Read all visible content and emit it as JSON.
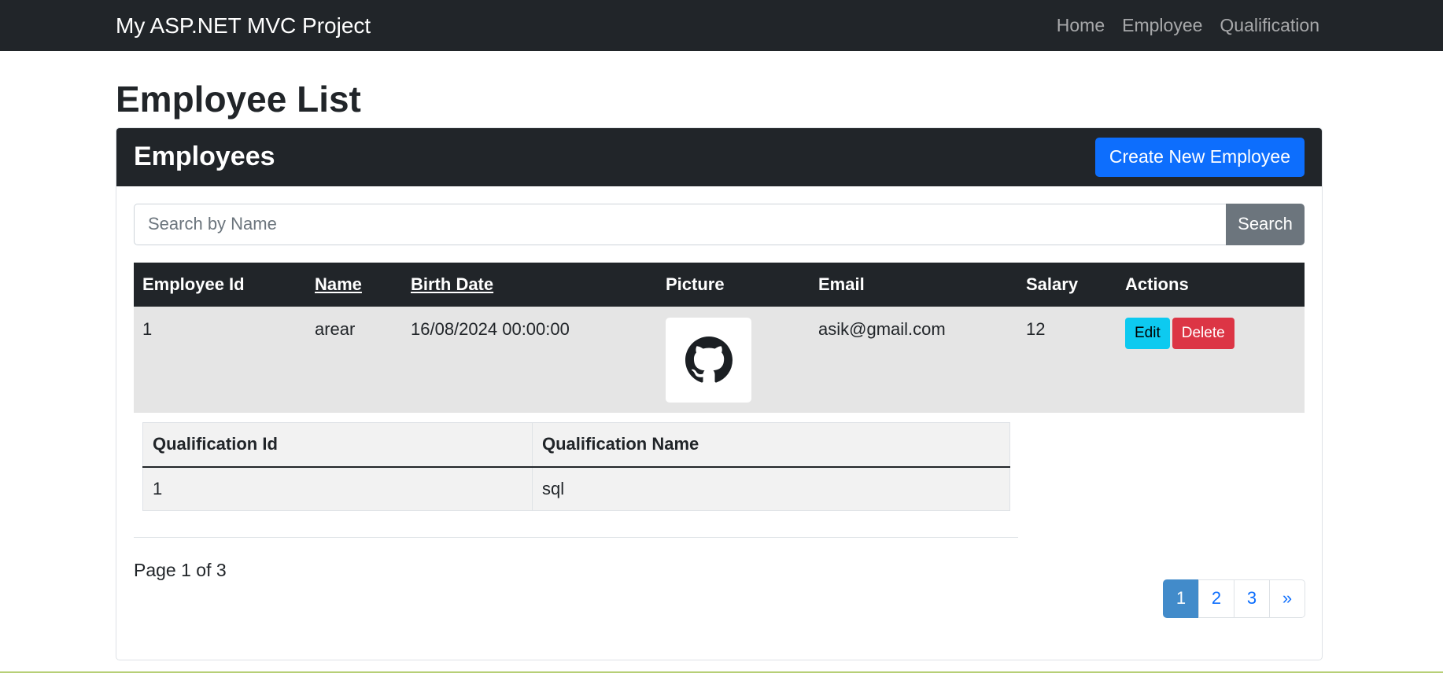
{
  "navbar": {
    "brand": "My ASP.NET MVC Project",
    "links": [
      "Home",
      "Employee",
      "Qualification"
    ]
  },
  "page_title": "Employee List",
  "card": {
    "title": "Employees",
    "create_button": "Create New Employee"
  },
  "search": {
    "placeholder": "Search by Name",
    "value": "",
    "button": "Search"
  },
  "table": {
    "headers": [
      "Employee Id",
      "Name",
      "Birth Date",
      "Picture",
      "Email",
      "Salary",
      "Actions"
    ],
    "rows": [
      {
        "id": "1",
        "name": "arear",
        "birth_date": "16/08/2024 00:00:00",
        "picture_icon": "github-icon",
        "email": "asik@gmail.com",
        "salary": "12",
        "edit": "Edit",
        "delete": "Delete"
      }
    ]
  },
  "qualifications": {
    "headers": [
      "Qualification Id",
      "Qualification Name"
    ],
    "rows": [
      {
        "id": "1",
        "name": "sql"
      }
    ]
  },
  "pagination": {
    "info": "Page 1 of 3",
    "pages": [
      "1",
      "2",
      "3"
    ],
    "next": "»",
    "current": 1
  },
  "colors": {
    "navbar": "#212529",
    "primary": "#0d6efd",
    "info": "#0dcaf0",
    "danger": "#dc3545",
    "secondary": "#6c757d"
  }
}
